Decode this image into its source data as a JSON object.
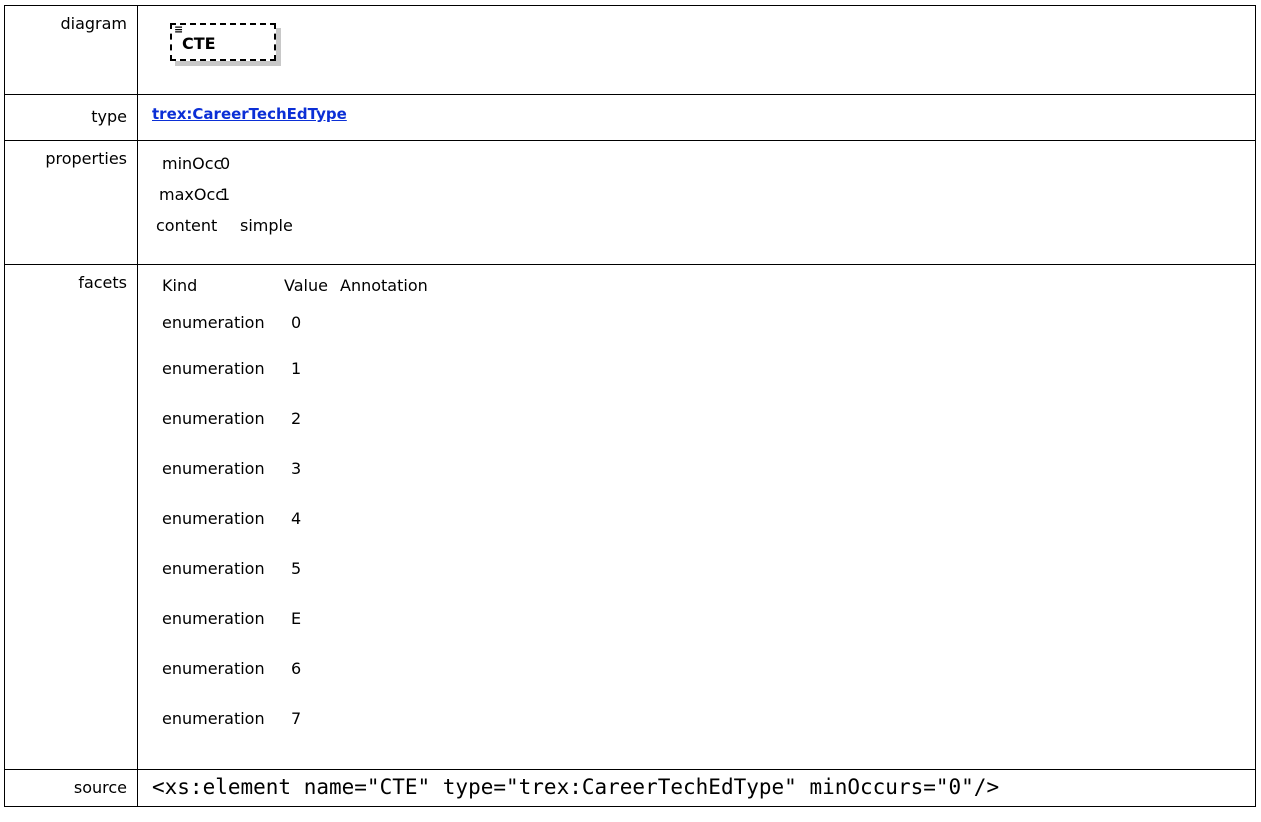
{
  "rows": {
    "diagram": {
      "label": "diagram",
      "icon_text": "CTE"
    },
    "type": {
      "label": "type",
      "link_text": "trex:CareerTechEdType"
    },
    "properties": {
      "label": "properties",
      "items": [
        {
          "key": "minOcc",
          "value": "0"
        },
        {
          "key": "maxOcc",
          "value": "1"
        },
        {
          "key": "content",
          "value": "simple"
        }
      ]
    },
    "facets": {
      "label": "facets",
      "headers": {
        "kind": "Kind",
        "value": "Value",
        "annotation": "Annotation"
      },
      "items": [
        {
          "kind": "enumeration",
          "value": "0"
        },
        {
          "kind": "enumeration",
          "value": "1"
        },
        {
          "kind": "enumeration",
          "value": "2"
        },
        {
          "kind": "enumeration",
          "value": "3"
        },
        {
          "kind": "enumeration",
          "value": "4"
        },
        {
          "kind": "enumeration",
          "value": "5"
        },
        {
          "kind": "enumeration",
          "value": "E"
        },
        {
          "kind": "enumeration",
          "value": "6"
        },
        {
          "kind": "enumeration",
          "value": "7"
        }
      ]
    },
    "source": {
      "label": "source",
      "code": "<xs:element name=\"CTE\" type=\"trex:CareerTechEdType\" minOccurs=\"0\"/>"
    }
  },
  "colors": {
    "link": "#0b2fd6",
    "shadow": "#c8c8c8"
  },
  "icons": {
    "diagram_element": "element-lines-icon"
  }
}
